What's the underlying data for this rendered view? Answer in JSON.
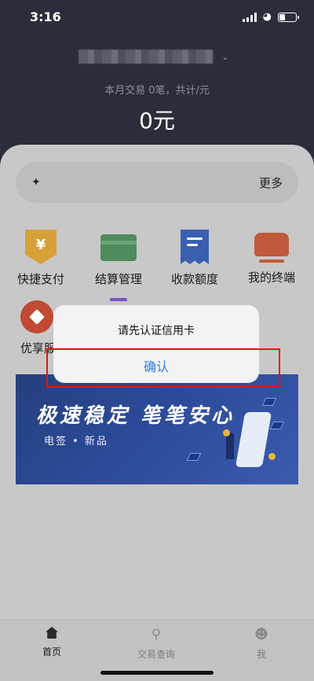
{
  "status": {
    "time": "3:16",
    "battery_level": 0.35
  },
  "header": {
    "summary": "本月交易 0笔，共计/元",
    "total": "0元"
  },
  "notice": {
    "icon": "bell-off-icon",
    "more": "更多"
  },
  "tiles": [
    {
      "label": "快捷支付",
      "icon": "yen-shield-icon"
    },
    {
      "label": "结算管理",
      "icon": "card-icon"
    },
    {
      "label": "收款额度",
      "icon": "receipt-icon"
    },
    {
      "label": "我的终端",
      "icon": "terminal-icon"
    },
    {
      "label": "优享服",
      "icon": "diamond-icon"
    }
  ],
  "banner": {
    "title": "极速稳定 笔笔安心",
    "subtitle": "电签 • 新品"
  },
  "dialog": {
    "message": "请先认证信用卡",
    "confirm": "确认"
  },
  "tabbar": {
    "tabs": [
      {
        "label": "首页",
        "icon": "home-icon",
        "active": true
      },
      {
        "label": "交易查询",
        "icon": "search-icon",
        "active": false
      },
      {
        "label": "我",
        "icon": "user-icon",
        "active": false
      }
    ]
  },
  "colors": {
    "dialog_button": "#2f7fe8",
    "highlight_box": "#ee1111"
  }
}
